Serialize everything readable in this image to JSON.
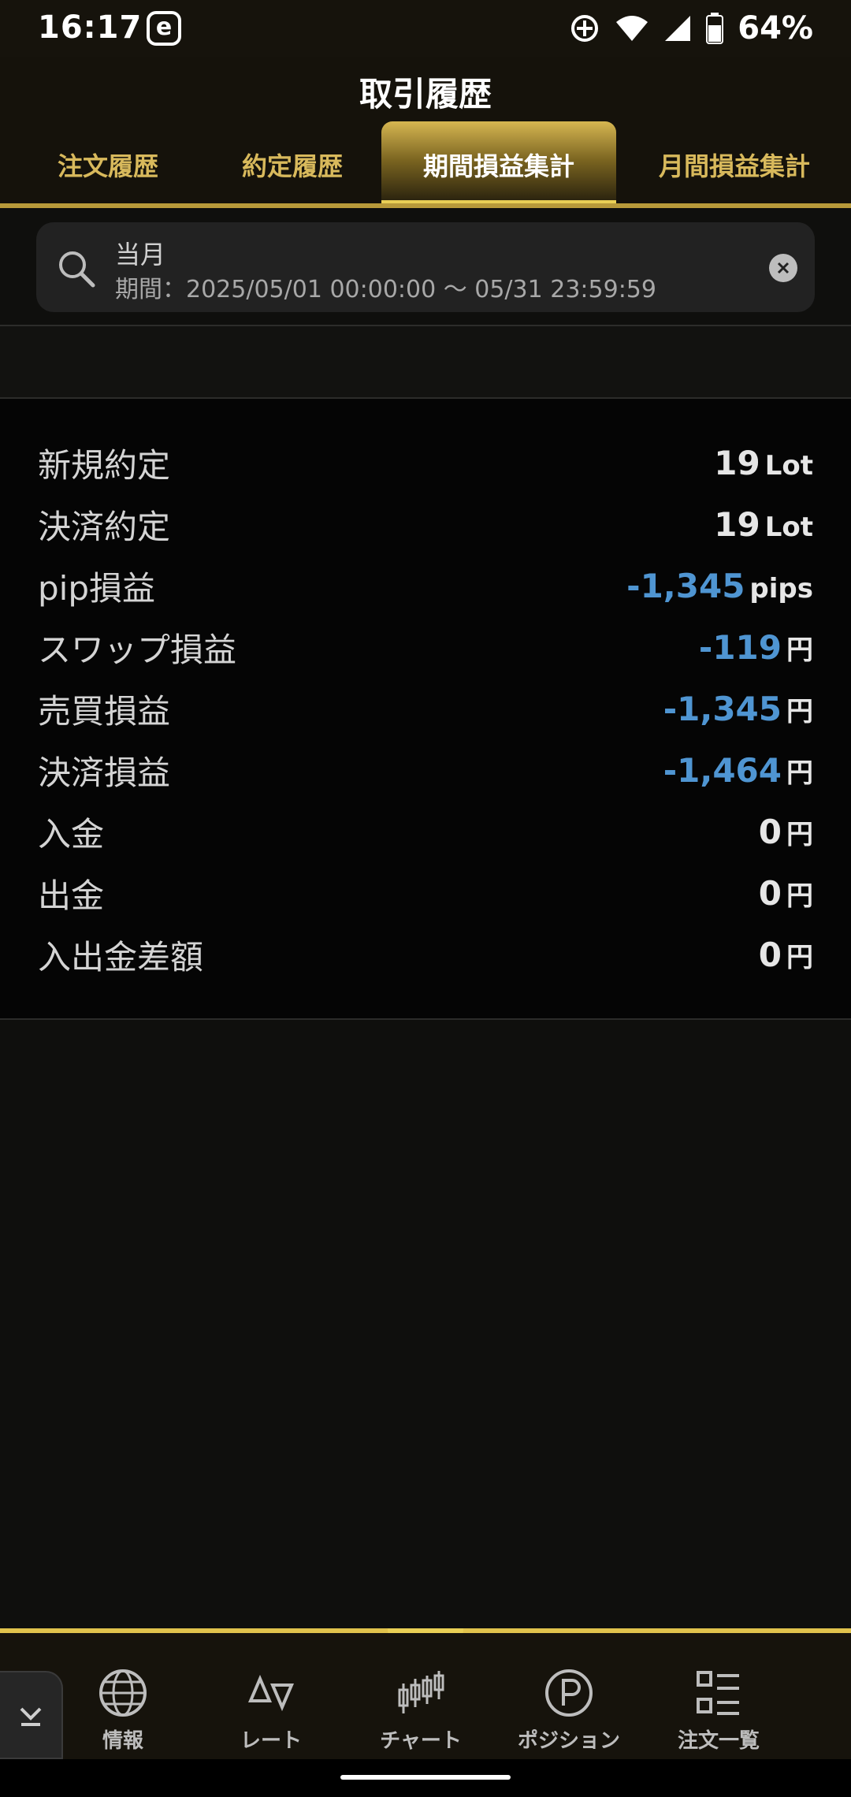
{
  "status_bar": {
    "time": "16:17",
    "app_badge": "e",
    "battery": "64%",
    "icons": [
      "sync-icon",
      "wifi-icon",
      "cell-signal-icon",
      "battery-icon"
    ]
  },
  "header": {
    "title": "取引履歴",
    "tabs": [
      {
        "label": "注文履歴",
        "active": false
      },
      {
        "label": "約定履歴",
        "active": false
      },
      {
        "label": "期間損益集計",
        "active": true
      },
      {
        "label": "月間損益集計",
        "active": false
      }
    ]
  },
  "search": {
    "title": "当月",
    "period": "期間：2025/05/01 00:00:00 ～ 05/31 23:59:59"
  },
  "summary": {
    "rows": [
      {
        "label": "新規約定",
        "value": "19",
        "unit": "Lot",
        "negative": false
      },
      {
        "label": "決済約定",
        "value": "19",
        "unit": "Lot",
        "negative": false
      },
      {
        "label": "pip損益",
        "value": "-1,345",
        "unit": "pips",
        "negative": true
      },
      {
        "label": "スワップ損益",
        "value": "-119",
        "unit": "円",
        "negative": true
      },
      {
        "label": "売買損益",
        "value": "-1,345",
        "unit": "円",
        "negative": true
      },
      {
        "label": "決済損益",
        "value": "-1,464",
        "unit": "円",
        "negative": true
      },
      {
        "label": "入金",
        "value": "0",
        "unit": "円",
        "negative": false
      },
      {
        "label": "出金",
        "value": "0",
        "unit": "円",
        "negative": false
      },
      {
        "label": "入出金差額",
        "value": "0",
        "unit": "円",
        "negative": false
      }
    ]
  },
  "bottom_nav": {
    "items": [
      {
        "label": "情報",
        "icon": "globe-icon"
      },
      {
        "label": "レート",
        "icon": "rate-triangles-icon"
      },
      {
        "label": "チャート",
        "icon": "candlestick-icon"
      },
      {
        "label": "ポジション",
        "icon": "position-p-icon"
      },
      {
        "label": "注文一覧",
        "icon": "order-list-icon"
      }
    ]
  },
  "colors": {
    "accent_gold": "#e0c24c",
    "tab_text": "#d8b95c",
    "negative_value": "#4f95d2"
  }
}
